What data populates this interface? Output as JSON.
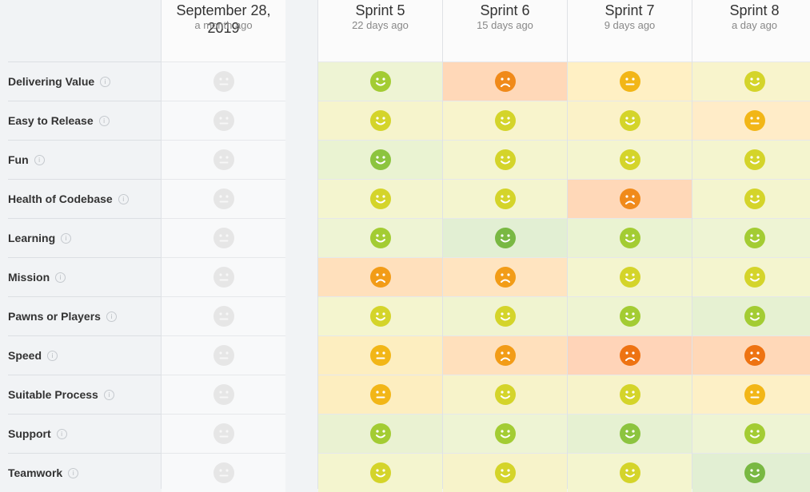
{
  "columns": [
    {
      "title": "September 28, 2019",
      "subtitle": "a month ago"
    },
    {
      "title": "Sprint 5",
      "subtitle": "22 days ago"
    },
    {
      "title": "Sprint 6",
      "subtitle": "15 days ago"
    },
    {
      "title": "Sprint 7",
      "subtitle": "9 days ago"
    },
    {
      "title": "Sprint 8",
      "subtitle": "a day ago"
    }
  ],
  "rows": [
    {
      "label": "Delivering Value",
      "faces": [
        "none",
        "lime-happy",
        "orange-sad",
        "amber-neutral",
        "yellow-happy"
      ]
    },
    {
      "label": "Easy to Release",
      "faces": [
        "none",
        "yellow-happy",
        "yellow-happy",
        "yellow-happy",
        "amber-neutral"
      ]
    },
    {
      "label": "Fun",
      "faces": [
        "none",
        "green-happy",
        "yellow-happy",
        "yellow-happy",
        "yellow-happy"
      ]
    },
    {
      "label": "Health of Codebase",
      "faces": [
        "none",
        "yellow-happy",
        "yellow-happy",
        "orange-sad",
        "yellow-happy"
      ]
    },
    {
      "label": "Learning",
      "faces": [
        "none",
        "lime-happy",
        "green-happy-big",
        "lime-happy",
        "lime-happy"
      ]
    },
    {
      "label": "Mission",
      "faces": [
        "none",
        "amber-sad",
        "amber-sad",
        "yellow-happy",
        "yellow-happy"
      ]
    },
    {
      "label": "Pawns or Players",
      "faces": [
        "none",
        "yellow-happy",
        "yellow-happy",
        "lime-happy",
        "lime-happy"
      ]
    },
    {
      "label": "Speed",
      "faces": [
        "none",
        "amber-neutral",
        "amber-sad",
        "orange-sad-dark",
        "orange-sad-dark"
      ]
    },
    {
      "label": "Suitable Process",
      "faces": [
        "none",
        "amber-neutral",
        "yellow-happy",
        "yellow-happy",
        "amber-neutral"
      ]
    },
    {
      "label": "Support",
      "faces": [
        "none",
        "lime-happy",
        "lime-happy",
        "green-happy",
        "lime-happy"
      ]
    },
    {
      "label": "Teamwork",
      "faces": [
        "none",
        "yellow-happy",
        "yellow-happy",
        "yellow-happy",
        "green-happy-big"
      ]
    }
  ],
  "cell_colors": [
    [
      "#f8f9fa",
      "#eef4d4",
      "#ffd8b8",
      "#fff0c4",
      "#f8f4cc"
    ],
    [
      "#f8f9fa",
      "#f6f4cc",
      "#f8f4cc",
      "#fbf2c8",
      "#ffecc8"
    ],
    [
      "#f8f9fa",
      "#eaf3d2",
      "#f4f5cf",
      "#f4f5cf",
      "#f4f5cf"
    ],
    [
      "#f8f9fa",
      "#f4f5cf",
      "#f4f5cf",
      "#ffd8b8",
      "#f4f5cf"
    ],
    [
      "#f8f9fa",
      "#eef4d4",
      "#e2efd3",
      "#eaf3d2",
      "#eef4d4"
    ],
    [
      "#f8f9fa",
      "#ffe0bc",
      "#ffe4c0",
      "#f4f5cf",
      "#f4f5cf"
    ],
    [
      "#f8f9fa",
      "#f4f5cf",
      "#f0f4d0",
      "#eef4d2",
      "#e6f1d2"
    ],
    [
      "#f8f9fa",
      "#fdeec0",
      "#ffe0bc",
      "#ffd4b8",
      "#ffd8b8"
    ],
    [
      "#f8f9fa",
      "#fdeec0",
      "#f7f3ca",
      "#f7f3ca",
      "#fdf0c6"
    ],
    [
      "#f8f9fa",
      "#eaf2d2",
      "#eef4d4",
      "#e6f1d2",
      "#eef4d4"
    ],
    [
      "#f8f9fa",
      "#f4f5cf",
      "#f7f3ca",
      "#f4f5cf",
      "#e2efd3"
    ]
  ],
  "face_colors": {
    "none": "#e6e6e6",
    "green-happy-big": "#79b843",
    "green-happy": "#8cc43f",
    "lime-happy": "#a3cc33",
    "yellow-happy": "#d4d42a",
    "amber-neutral": "#f2b617",
    "amber-sad": "#f29c17",
    "orange-sad": "#f08a1a",
    "orange-sad-dark": "#ee7312"
  },
  "info_glyph": "i"
}
